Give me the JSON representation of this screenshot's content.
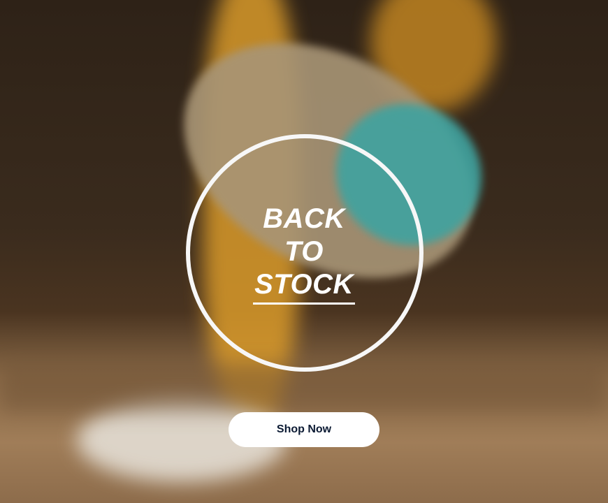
{
  "banner": {
    "headline": [
      "BACK",
      "TO",
      "STOCK"
    ],
    "cta_label": "Shop Now"
  },
  "colors": {
    "accent": "#ffffff",
    "button_text": "#0b1a33"
  }
}
